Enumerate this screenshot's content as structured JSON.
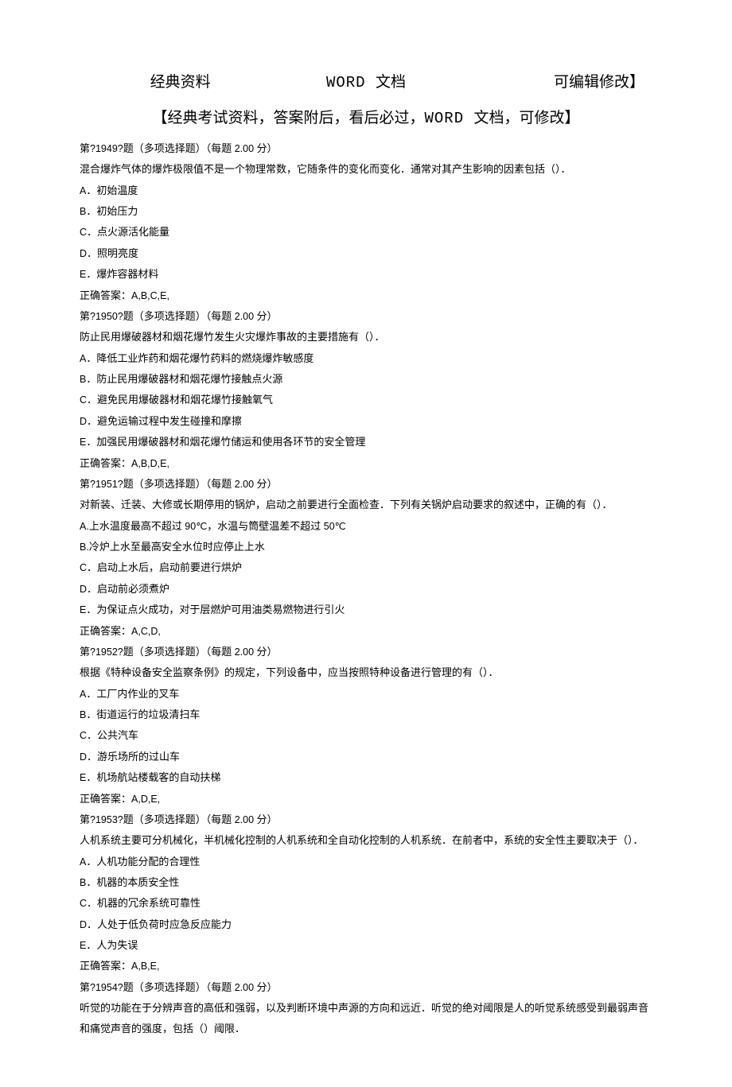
{
  "header": {
    "left": "经典资料",
    "mid_mono": "WORD ",
    "mid_cn": "文档",
    "right": "可编辑修改】"
  },
  "subtitle": {
    "prefix": "【经典考试资料，答案附后，看后必过，",
    "mono": "WORD ",
    "suffix": "文档，可修改】"
  },
  "questions": [
    {
      "header": "第?1949?题（多项选择题）（每题 2.00 分）",
      "stem": "混合爆炸气体的爆炸极限值不是一个物理常数，它随条件的变化而变化．通常对其产生影响的因素包括（）．",
      "options": [
        "A．初始温度",
        "B．初始压力",
        "C．点火源活化能量",
        "D．照明亮度",
        "E．爆炸容器材料"
      ],
      "answer": "正确答案：A,B,C,E,"
    },
    {
      "header": "第?1950?题（多项选择题）（每题 2.00 分）",
      "stem": "防止民用爆破器材和烟花爆竹发生火灾爆炸事故的主要措施有（）．",
      "options": [
        "A．降低工业炸药和烟花爆竹药料的燃烧爆炸敏感度",
        "B．防止民用爆破器材和烟花爆竹接触点火源",
        "C．避免民用爆破器材和烟花爆竹接触氧气",
        "D．避免运输过程中发生碰撞和摩擦",
        "E．加强民用爆破器材和烟花爆竹储运和使用各环节的安全管理"
      ],
      "answer": "正确答案：A,B,D,E,"
    },
    {
      "header": "第?1951?题（多项选择题）（每题 2.00 分）",
      "stem": "对新装、迁装、大修或长期停用的锅炉，启动之前要进行全面检查．下列有关锅炉启动要求的叙述中，正确的有（）．",
      "options": [
        "A.上水温度最高不超过 90℃，水温与筒壁温差不超过 50℃",
        "B.冷炉上水至最高安全水位时应停止上水",
        "C．启动上水后，启动前要进行烘炉",
        "D．启动前必须煮炉",
        "E．为保证点火成功，对于层燃炉可用油类易燃物进行引火"
      ],
      "answer": "正确答案：A,C,D,"
    },
    {
      "header": "第?1952?题（多项选择题）（每题 2.00 分）",
      "stem": "根据《特种设备安全监察条例》的规定，下列设备中，应当按照特种设备进行管理的有（）．",
      "options": [
        "A．工厂内作业的叉车",
        "B．街道运行的垃圾清扫车",
        "C．公共汽车",
        "D．游乐场所的过山车",
        "E．机场航站楼载客的自动扶梯"
      ],
      "answer": "正确答案：A,D,E,"
    },
    {
      "header": "第?1953?题（多项选择题）（每题 2.00 分）",
      "stem": "人机系统主要可分机械化，半机械化控制的人机系统和全自动化控制的人机系统．在前者中，系统的安全性主要取决于（）．",
      "options": [
        "A．人机功能分配的合理性",
        "B．机器的本质安全性",
        "C．机器的冗余系统可靠性",
        "D．人处于低负荷时应急反应能力",
        "E．人为失误"
      ],
      "answer": "正确答案：A,B,E,"
    },
    {
      "header": "第?1954?题（多项选择题）（每题 2.00 分）",
      "stem": "听觉的功能在于分辨声音的高低和强弱，以及判断环境中声源的方向和远近．听觉的绝对阈限是人的听觉系统感受到最弱声音和痛觉声音的强度，包括（）阈限．",
      "options": [],
      "answer": ""
    }
  ]
}
